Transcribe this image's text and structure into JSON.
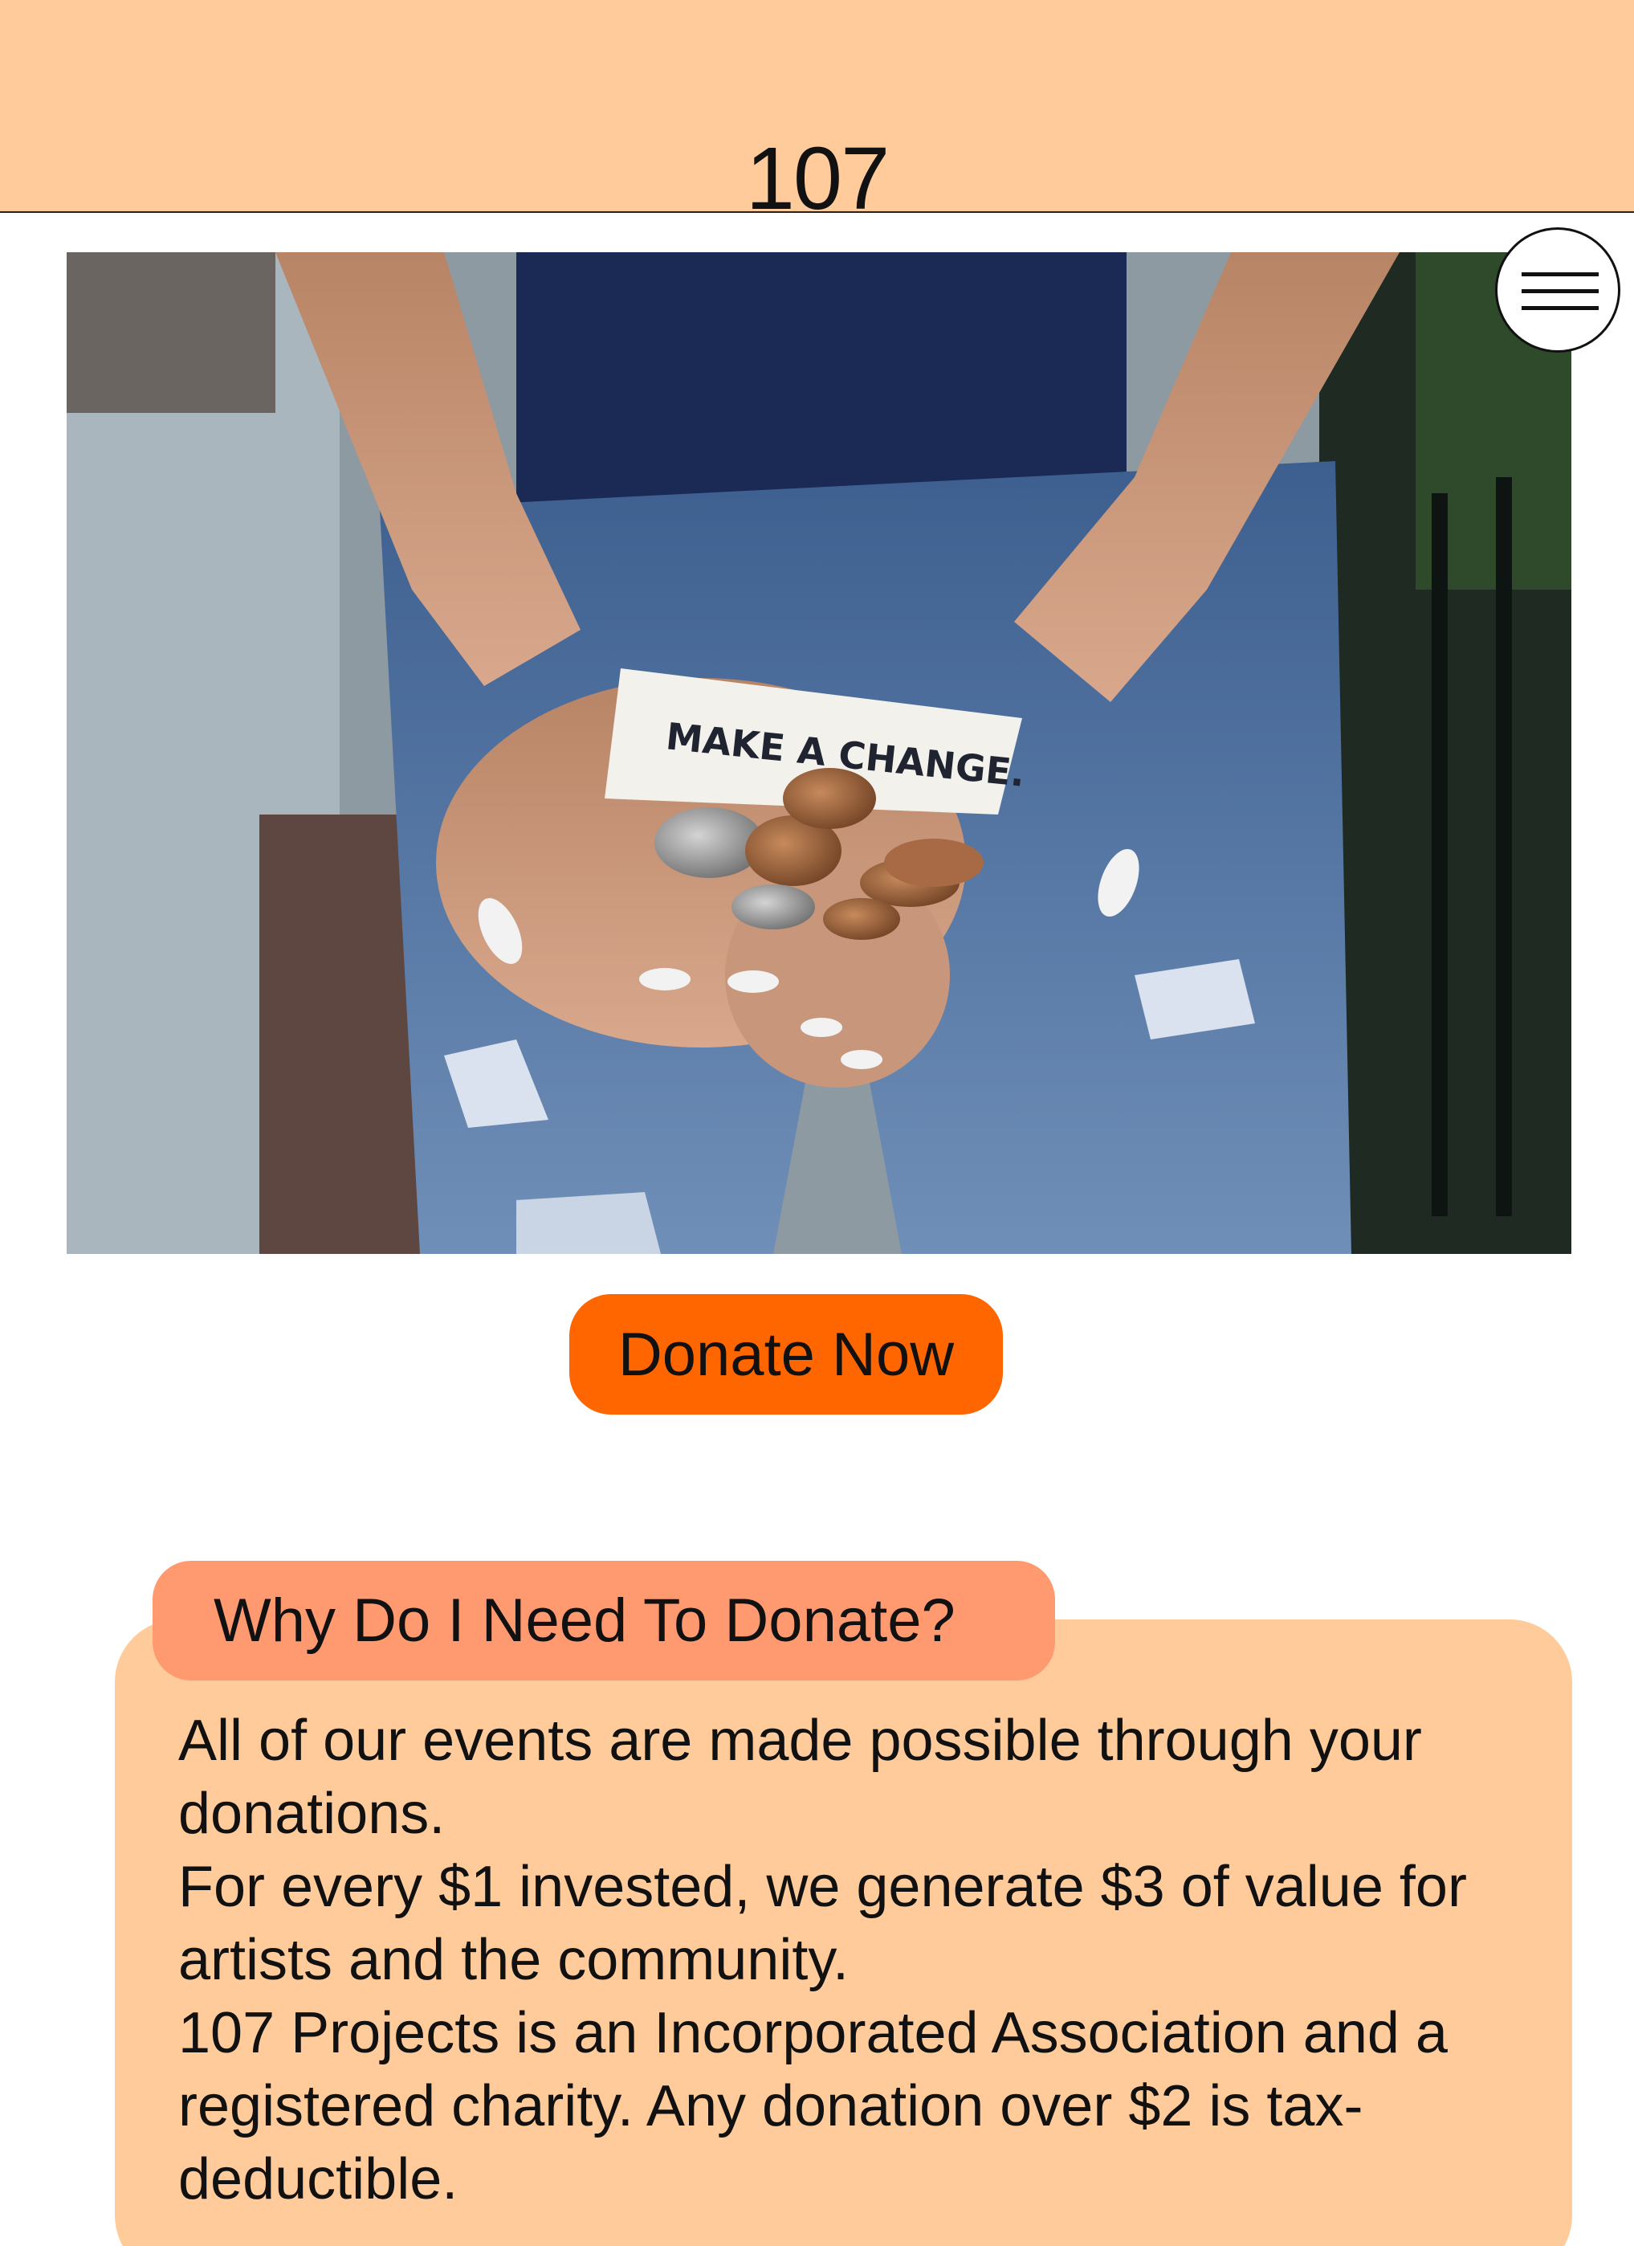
{
  "header": {
    "logo_text": "107",
    "background_color": "#ffcb9a"
  },
  "menu": {
    "icon": "hamburger-menu-icon"
  },
  "hero": {
    "photo_caption_text": "MAKE A CHANGE."
  },
  "donate": {
    "label": "Donate Now",
    "color": "#ff6600"
  },
  "info_card": {
    "title": "Why Do I Need To Donate?",
    "title_color": "#ff9a70",
    "card_color": "#ffcb9a",
    "paragraphs": [
      "All of our events are made possible through your donations.",
      "For every $1 invested, we generate $3 of value for artists and the community.",
      "107 Projects is an Incorporated Association and a registered charity. Any donation over $2 is tax-deductible."
    ]
  }
}
